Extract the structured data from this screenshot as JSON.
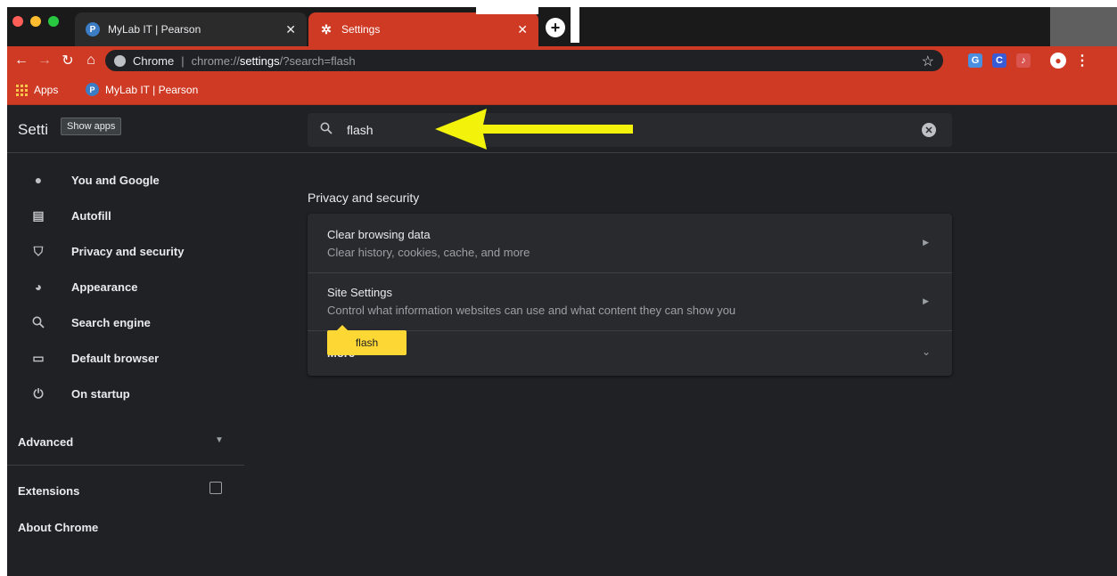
{
  "colors": {
    "accent_red": "#cf3a24",
    "page_bg": "#202124",
    "card_bg": "#292a2d",
    "highlight_yellow": "#fdd835",
    "annotation_arrow": "#f2f20a"
  },
  "tabs": [
    {
      "title": "MyLab IT | Pearson",
      "icon": "pearson-icon",
      "active": false
    },
    {
      "title": "Settings",
      "icon": "gear-icon",
      "active": true
    }
  ],
  "toolbar": {
    "chip_label": "Chrome",
    "separator": "|",
    "url_prefix": "chrome://",
    "url_host": "settings",
    "url_rest": "/?search=flash"
  },
  "bookmarks": {
    "apps_label": "Apps",
    "items": [
      {
        "label": "MyLab IT | Pearson",
        "icon": "pearson-icon"
      }
    ]
  },
  "header": {
    "title": "Setti",
    "tooltip": "Show apps",
    "search_value": "flash"
  },
  "sidebar": {
    "items": [
      {
        "label": "You and Google",
        "icon": "person-icon"
      },
      {
        "label": "Autofill",
        "icon": "clipboard-icon"
      },
      {
        "label": "Privacy and security",
        "icon": "shield-icon"
      },
      {
        "label": "Appearance",
        "icon": "palette-icon"
      },
      {
        "label": "Search engine",
        "icon": "search-icon"
      },
      {
        "label": "Default browser",
        "icon": "browser-icon"
      },
      {
        "label": "On startup",
        "icon": "power-icon"
      }
    ],
    "advanced_label": "Advanced",
    "extensions_label": "Extensions",
    "about_label": "About Chrome"
  },
  "main": {
    "section_title": "Privacy and security",
    "rows": [
      {
        "title": "Clear browsing data",
        "subtitle": "Clear history, cookies, cache, and more"
      },
      {
        "title": "Site Settings",
        "subtitle": "Control what information websites can use and what content they can show you"
      }
    ],
    "more_label": "More",
    "flash_tip": "flash"
  }
}
